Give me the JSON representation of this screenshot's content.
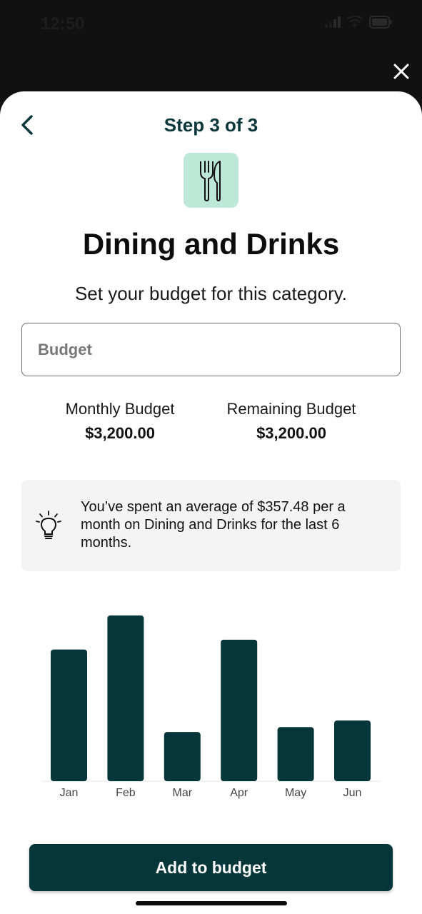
{
  "status_bar": {
    "time": "12:50"
  },
  "header": {
    "step": "Step 3 of 3"
  },
  "category": {
    "icon": "fork-knife-icon",
    "title": "Dining and Drinks",
    "subtitle": "Set your budget for this category."
  },
  "budget_input": {
    "placeholder": "Budget",
    "value": ""
  },
  "stats": {
    "monthly": {
      "label": "Monthly Budget",
      "value": "$3,200.00"
    },
    "remaining": {
      "label": "Remaining Budget",
      "value": "$3,200.00"
    }
  },
  "tip": {
    "icon": "lightbulb-icon",
    "text": "You’ve spent an average of $357.48 per a month on Dining and Drinks for the last 6 months."
  },
  "chart_data": {
    "type": "bar",
    "categories": [
      "Jan",
      "Feb",
      "Mar",
      "Apr",
      "May",
      "Jun"
    ],
    "values": [
      375,
      472,
      140,
      403,
      154,
      173
    ],
    "title": "",
    "xlabel": "",
    "ylabel": "",
    "ylim": [
      0,
      480
    ],
    "grid": false,
    "color": "#05363a"
  },
  "actions": {
    "add_label": "Add to budget"
  },
  "colors": {
    "accent": "#05363a",
    "icon_bg": "#bde8d7",
    "tip_bg": "#f4f4f4"
  }
}
